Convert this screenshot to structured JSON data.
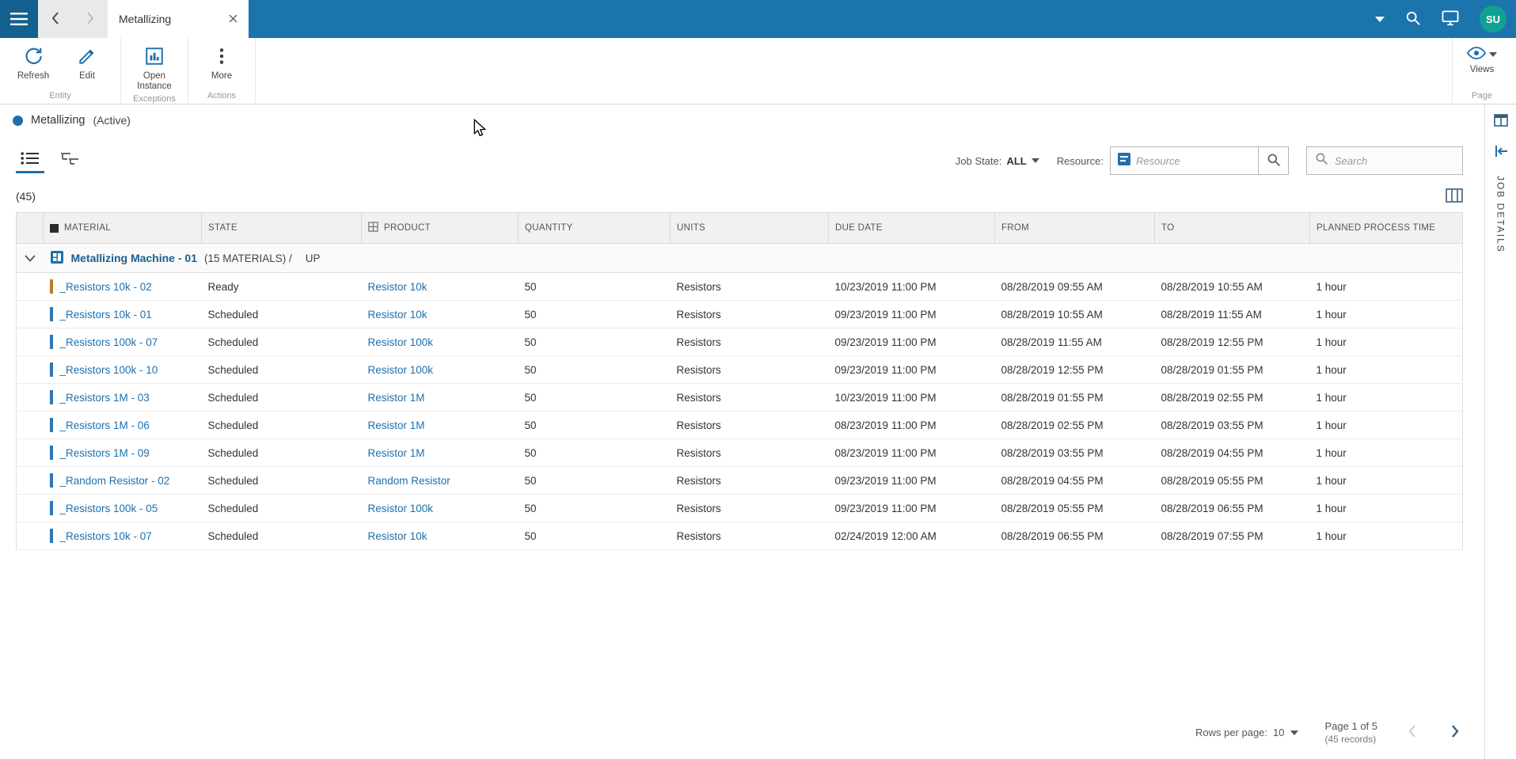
{
  "colors": {
    "topbar_blue": "#1b74ac",
    "accent_blue": "#1d70ad",
    "avatar_teal": "#11a192",
    "ready_bar": "#c07a2b",
    "scheduled_bar": "#2e76b4"
  },
  "topbar": {
    "tab_title": "Metallizing",
    "avatar_initials": "SU"
  },
  "ribbon": {
    "refresh_label": "Refresh",
    "edit_label": "Edit",
    "open_instance_label": "Open Instance",
    "more_label": "More",
    "group_entity": "Entity",
    "group_exceptions": "Exceptions",
    "group_actions": "Actions",
    "views_label": "Views",
    "page_label": "Page"
  },
  "status": {
    "title": "Metallizing",
    "state": "(Active)"
  },
  "filters": {
    "job_state_label": "Job State:",
    "job_state_value": "ALL",
    "resource_label": "Resource:",
    "resource_placeholder": "Resource",
    "search_placeholder": "Search"
  },
  "grid": {
    "count": "(45)",
    "columns": [
      "MATERIAL",
      "STATE",
      "PRODUCT",
      "QUANTITY",
      "UNITS",
      "DUE DATE",
      "FROM",
      "TO",
      "PLANNED PROCESS TIME"
    ],
    "group": {
      "title": "Metallizing Machine - 01",
      "subtitle": "(15 MATERIALS) /",
      "status": "UP"
    },
    "rows": [
      {
        "material": "_Resistors 10k - 02",
        "state": "Ready",
        "product": "Resistor 10k",
        "quantity": "50",
        "units": "Resistors",
        "due": "10/23/2019 11:00 PM",
        "from": "08/28/2019 09:55 AM",
        "to": "08/28/2019 10:55 AM",
        "planned": "1 hour",
        "state_color": "#c07a2b"
      },
      {
        "material": "_Resistors 10k - 01",
        "state": "Scheduled",
        "product": "Resistor 10k",
        "quantity": "50",
        "units": "Resistors",
        "due": "09/23/2019 11:00 PM",
        "from": "08/28/2019 10:55 AM",
        "to": "08/28/2019 11:55 AM",
        "planned": "1 hour",
        "state_color": "#2e76b4"
      },
      {
        "material": "_Resistors 100k - 07",
        "state": "Scheduled",
        "product": "Resistor 100k",
        "quantity": "50",
        "units": "Resistors",
        "due": "09/23/2019 11:00 PM",
        "from": "08/28/2019 11:55 AM",
        "to": "08/28/2019 12:55 PM",
        "planned": "1 hour",
        "state_color": "#2e76b4"
      },
      {
        "material": "_Resistors 100k - 10",
        "state": "Scheduled",
        "product": "Resistor 100k",
        "quantity": "50",
        "units": "Resistors",
        "due": "09/23/2019 11:00 PM",
        "from": "08/28/2019 12:55 PM",
        "to": "08/28/2019 01:55 PM",
        "planned": "1 hour",
        "state_color": "#2e76b4"
      },
      {
        "material": "_Resistors 1M - 03",
        "state": "Scheduled",
        "product": "Resistor 1M",
        "quantity": "50",
        "units": "Resistors",
        "due": "10/23/2019 11:00 PM",
        "from": "08/28/2019 01:55 PM",
        "to": "08/28/2019 02:55 PM",
        "planned": "1 hour",
        "state_color": "#2e76b4"
      },
      {
        "material": "_Resistors 1M - 06",
        "state": "Scheduled",
        "product": "Resistor 1M",
        "quantity": "50",
        "units": "Resistors",
        "due": "08/23/2019 11:00 PM",
        "from": "08/28/2019 02:55 PM",
        "to": "08/28/2019 03:55 PM",
        "planned": "1 hour",
        "state_color": "#2e76b4"
      },
      {
        "material": "_Resistors 1M - 09",
        "state": "Scheduled",
        "product": "Resistor 1M",
        "quantity": "50",
        "units": "Resistors",
        "due": "08/23/2019 11:00 PM",
        "from": "08/28/2019 03:55 PM",
        "to": "08/28/2019 04:55 PM",
        "planned": "1 hour",
        "state_color": "#2e76b4"
      },
      {
        "material": "_Random Resistor - 02",
        "state": "Scheduled",
        "product": "Random Resistor",
        "quantity": "50",
        "units": "Resistors",
        "due": "09/23/2019 11:00 PM",
        "from": "08/28/2019 04:55 PM",
        "to": "08/28/2019 05:55 PM",
        "planned": "1 hour",
        "state_color": "#2e76b4"
      },
      {
        "material": "_Resistors 100k - 05",
        "state": "Scheduled",
        "product": "Resistor 100k",
        "quantity": "50",
        "units": "Resistors",
        "due": "09/23/2019 11:00 PM",
        "from": "08/28/2019 05:55 PM",
        "to": "08/28/2019 06:55 PM",
        "planned": "1 hour",
        "state_color": "#2e76b4"
      },
      {
        "material": "_Resistors 10k - 07",
        "state": "Scheduled",
        "product": "Resistor 10k",
        "quantity": "50",
        "units": "Resistors",
        "due": "02/24/2019 12:00 AM",
        "from": "08/28/2019 06:55 PM",
        "to": "08/28/2019 07:55 PM",
        "planned": "1 hour",
        "state_color": "#2e76b4"
      }
    ]
  },
  "pagination": {
    "rows_per_page_label": "Rows per page:",
    "rows_per_page_value": "10",
    "page_label": "Page 1 of 5",
    "records_label": "(45 records)"
  },
  "right_rail": {
    "title": "JOB DETAILS"
  }
}
